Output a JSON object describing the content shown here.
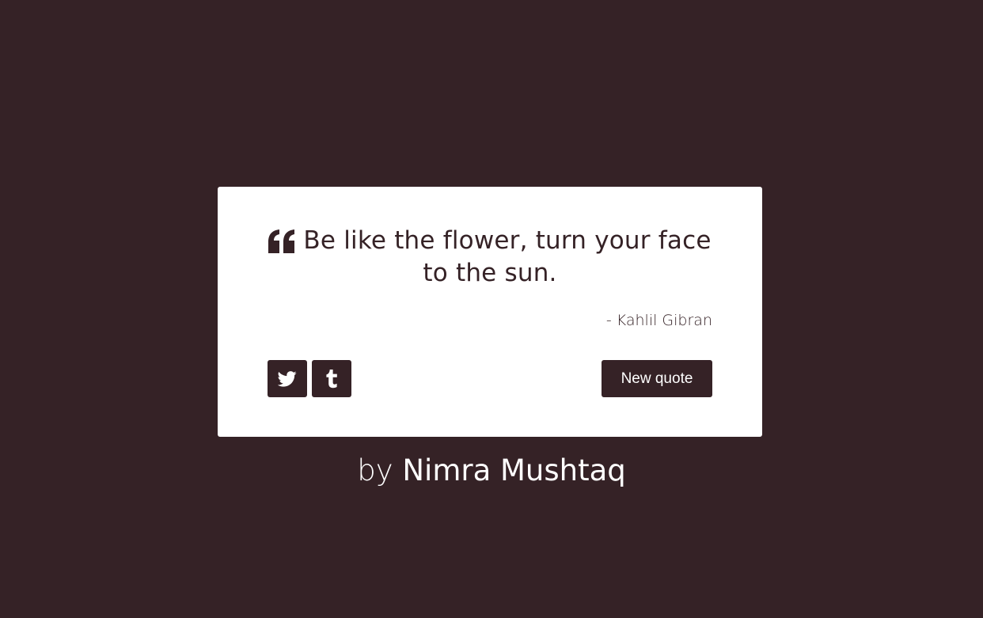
{
  "colors": {
    "background": "#352226",
    "card": "#ffffff",
    "accent": "#352226",
    "button_text": "#ffffff"
  },
  "quote": {
    "icon": "quote-left-icon",
    "text": "Be like the flower, turn your face to the sun.",
    "author": "- Kahlil Gibran"
  },
  "share": {
    "twitter_icon": "twitter-icon",
    "tumblr_icon": "tumblr-icon"
  },
  "new_quote_label": "New quote",
  "credit": {
    "prefix": "by ",
    "name": "Nimra Mushtaq"
  }
}
